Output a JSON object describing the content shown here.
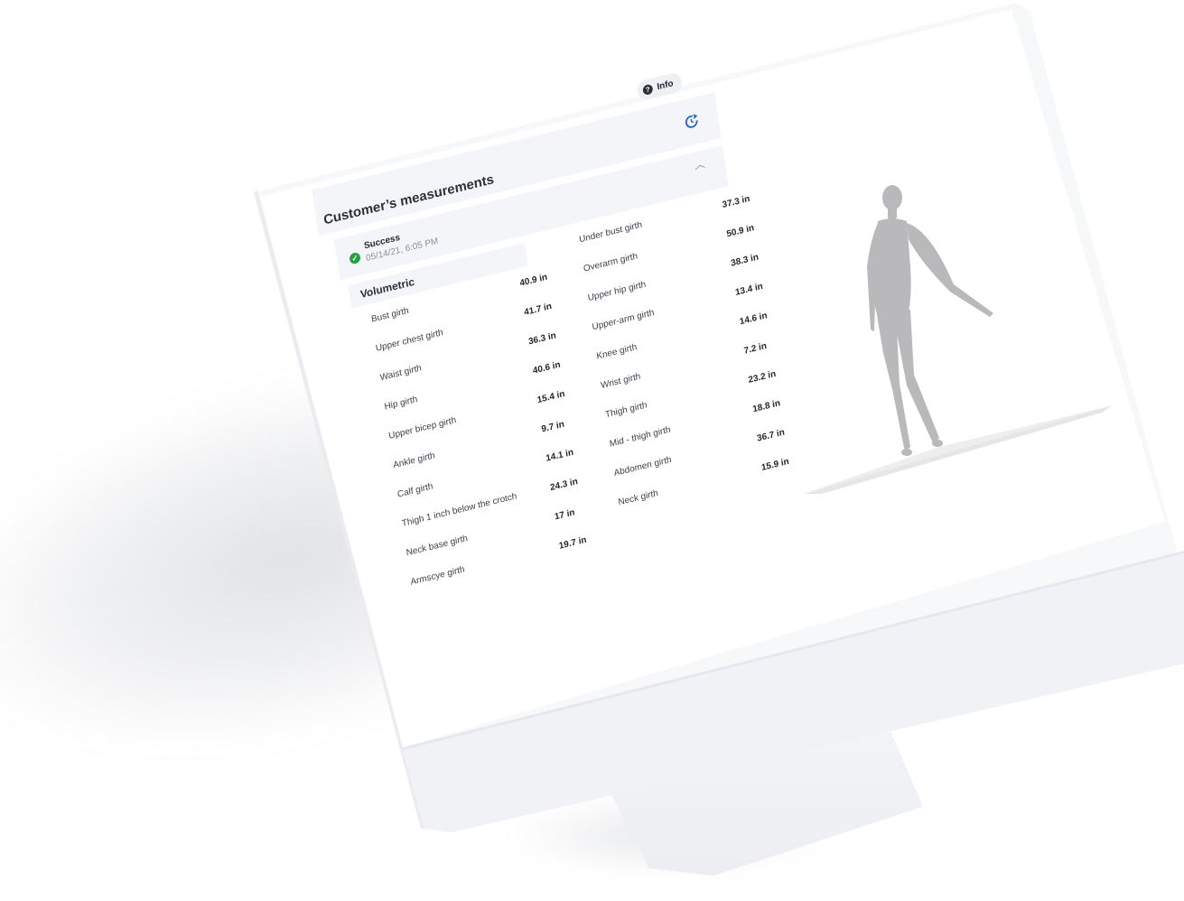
{
  "header": {
    "info_label": "Info",
    "title": "Customer’s measurements",
    "refresh_icon": "refresh-icon"
  },
  "status": {
    "label": "Success",
    "timestamp": "05/14/21, 6:05 PM",
    "icon": "check-circle-icon",
    "color": "#23a043"
  },
  "section": {
    "title": "Volumetric",
    "collapse_icon": "chevron-up-icon"
  },
  "measurements_left": [
    {
      "label": "Bust girth",
      "value": "40.9 in"
    },
    {
      "label": "Upper chest girth",
      "value": "41.7 in"
    },
    {
      "label": "Waist girth",
      "value": "36.3 in"
    },
    {
      "label": "Hip girth",
      "value": "40.6 in"
    },
    {
      "label": "Upper bicep girth",
      "value": "15.4 in"
    },
    {
      "label": "Ankle girth",
      "value": "9.7 in"
    },
    {
      "label": "Calf girth",
      "value": "14.1 in"
    },
    {
      "label": "Thigh 1 inch below the crotch",
      "value": "24.3 in"
    },
    {
      "label": "Neck base girth",
      "value": "17 in"
    },
    {
      "label": "Armscye girth",
      "value": "19.7 in"
    }
  ],
  "measurements_right": [
    {
      "label": "Under bust girth",
      "value": "37.3 in"
    },
    {
      "label": "Overarm girth",
      "value": "50.9 in"
    },
    {
      "label": "Upper hip girth",
      "value": "38.3 in"
    },
    {
      "label": "Upper-arm girth",
      "value": "13.4 in"
    },
    {
      "label": "Knee girth",
      "value": "14.6 in"
    },
    {
      "label": "Wrist girth",
      "value": "7.2 in"
    },
    {
      "label": "Thigh girth",
      "value": "23.2 in"
    },
    {
      "label": "Mid - thigh girth",
      "value": "18.8 in"
    },
    {
      "label": "Abdomen girth",
      "value": "36.7 in"
    },
    {
      "label": "Neck girth",
      "value": "15.9 in"
    }
  ],
  "colors": {
    "accent": "#1f5fbf",
    "panel": "#f4f5f8",
    "avatar": "#b9b9bc"
  }
}
